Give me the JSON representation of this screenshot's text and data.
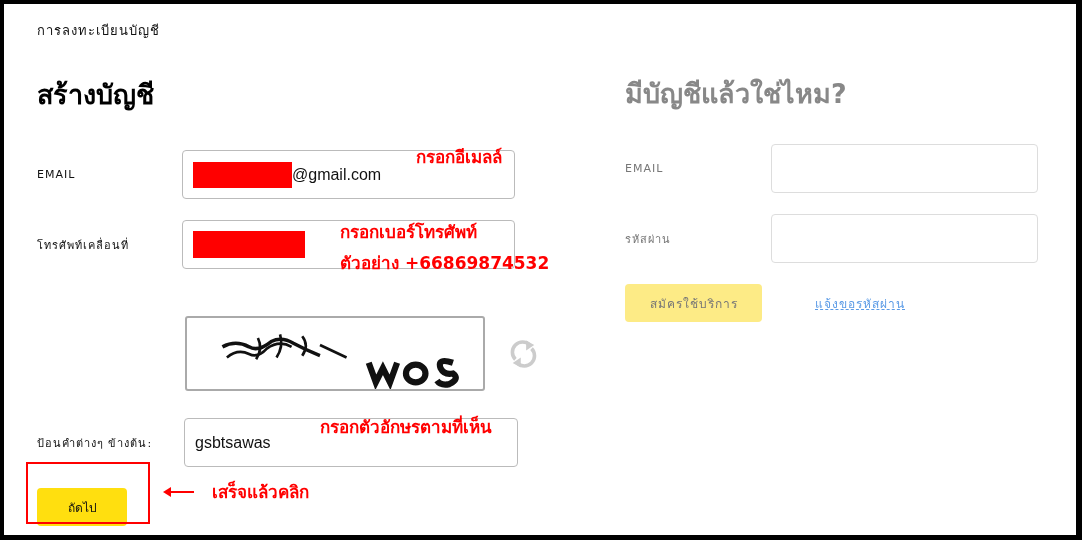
{
  "breadcrumb": "การลงทะเบียนบัญชี",
  "signup": {
    "title": "สร้างบัญชี",
    "fields": [
      {
        "label": "EMAIL",
        "value": "@gmail.com",
        "redacted": true
      },
      {
        "label": "โทรศัพท์เคลื่อนที่",
        "redacted": true
      }
    ],
    "captcha": {
      "label": "ป้อนคำต่างๆ ข้างต้น:",
      "value": "gsbtsawas"
    },
    "next_button": "ถัดไป"
  },
  "login": {
    "title": "มีบัญชีแล้วใช่ไหม?",
    "fields": [
      {
        "label": "EMAIL"
      },
      {
        "label": "รหัสผ่าน"
      }
    ],
    "submit_button": "สมัครใช้บริการ",
    "forgot_link": "แจ้งขอรหัสผ่าน"
  },
  "annotations": {
    "email_hint": "กรอกอีเมลล์",
    "phone_hint": "กรอกเบอร์โทรศัพท์",
    "phone_example": "ตัวอย่าง +66869874532",
    "captcha_hint": "กรอกตัวอักษรตามที่เห็น",
    "next_hint": "เสร็จแล้วคลิก"
  }
}
